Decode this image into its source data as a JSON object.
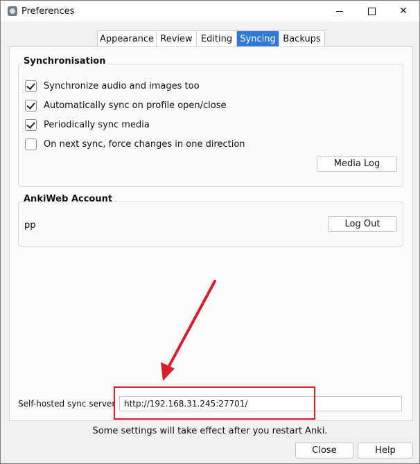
{
  "window": {
    "title": "Preferences",
    "controls": [
      "minimize-icon",
      "maximize-icon",
      "close-icon"
    ]
  },
  "tabs": [
    {
      "label": "Appearance",
      "active": false
    },
    {
      "label": "Review",
      "active": false
    },
    {
      "label": "Editing",
      "active": false
    },
    {
      "label": "Syncing",
      "active": true
    },
    {
      "label": "Backups",
      "active": false
    }
  ],
  "synchronisation": {
    "title": "Synchronisation",
    "options": [
      {
        "label": "Synchronize audio and images too",
        "checked": true
      },
      {
        "label": "Automatically sync on profile open/close",
        "checked": true
      },
      {
        "label": "Periodically sync media",
        "checked": true
      },
      {
        "label": "On next sync, force changes in one direction",
        "checked": false
      }
    ],
    "media_log_label": "Media Log"
  },
  "account": {
    "title": "AnkiWeb Account",
    "username": "pp",
    "logout_label": "Log Out"
  },
  "sync_server": {
    "label": "Self-hosted sync server",
    "value": "http://192.168.31.245:27701/"
  },
  "footer": {
    "note": "Some settings will take effect after you restart Anki.",
    "close_label": "Close",
    "help_label": "Help"
  },
  "annotation": {
    "arrow_color": "#d81e28",
    "highlight_color": "#d81e28"
  }
}
